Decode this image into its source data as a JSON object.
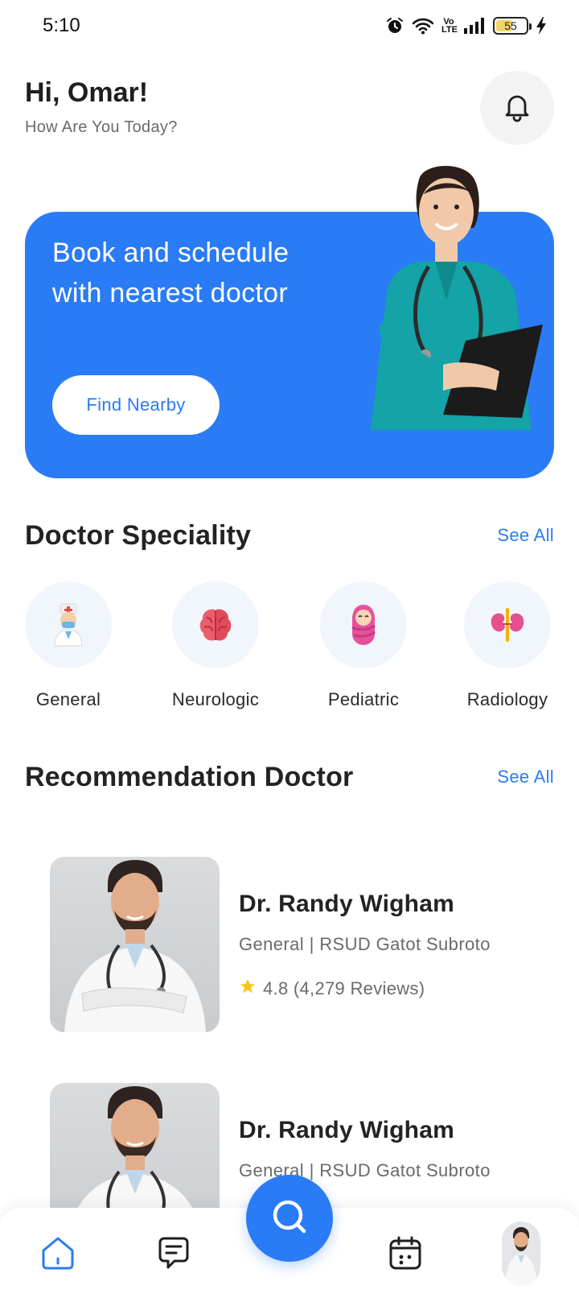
{
  "status_bar": {
    "time": "5:10",
    "network_label": "Vo LTE",
    "battery_level": "55",
    "battery_fraction": 0.55,
    "icons": [
      "alarm-icon",
      "wifi-icon",
      "volte-icon",
      "signal-icon",
      "battery-icon",
      "charging-icon"
    ]
  },
  "header": {
    "greeting": "Hi, Omar!",
    "subtitle": "How Are You Today?",
    "notification_icon": "bell-icon"
  },
  "banner": {
    "text": "Book and schedule with nearest doctor",
    "button_label": "Find Nearby",
    "background_color": "#2a7bf6"
  },
  "speciality": {
    "title": "Doctor Speciality",
    "see_all": "See All",
    "items": [
      {
        "label": "General",
        "icon": "doctor-icon"
      },
      {
        "label": "Neurologic",
        "icon": "brain-icon"
      },
      {
        "label": "Pediatric",
        "icon": "baby-icon"
      },
      {
        "label": "Radiology",
        "icon": "kidney-icon"
      }
    ]
  },
  "recommendation": {
    "title": "Recommendation Doctor",
    "see_all": "See All",
    "doctors": [
      {
        "name": "Dr. Randy Wigham",
        "meta": "General | RSUD Gatot Subroto",
        "rating": "4.8 (4,279 Reviews)"
      },
      {
        "name": "Dr. Randy Wigham",
        "meta": "General | RSUD Gatot Subroto",
        "rating": ""
      }
    ]
  },
  "bottom_nav": {
    "items": [
      "home-icon",
      "chat-icon",
      "search-icon",
      "calendar-icon",
      "profile-avatar"
    ],
    "active": "home-icon"
  },
  "colors": {
    "accent": "#2a7bf6",
    "star": "#f5c518",
    "text_primary": "#232323",
    "text_secondary": "#6a6a6a"
  }
}
